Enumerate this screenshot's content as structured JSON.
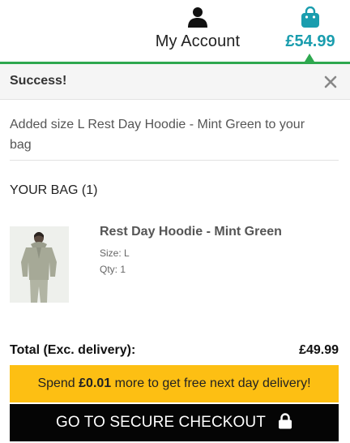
{
  "header": {
    "account_label": "My Account",
    "account_icon": "user-icon",
    "bag_total": "£54.99",
    "bag_icon": "shopping-bag-icon",
    "accent_color": "#1a9dae",
    "underline_color": "#2ea84f"
  },
  "notification": {
    "title": "Success!",
    "close_icon": "close-icon",
    "message": "Added size L Rest Day Hoodie - Mint Green to your bag"
  },
  "bag": {
    "heading": "YOUR BAG (1)",
    "items": [
      {
        "name": "Rest Day Hoodie - Mint Green",
        "size": "Size: L",
        "qty": "Qty: 1",
        "image": "hoodie-product-image"
      }
    ]
  },
  "totals": {
    "label": "Total (Exc. delivery):",
    "value": "£49.99"
  },
  "promo": {
    "prefix": "Spend ",
    "amount": "£0.01",
    "suffix": " more to get free next day delivery!",
    "color": "#fdbf13"
  },
  "checkout": {
    "label": "GO TO SECURE CHECKOUT",
    "icon": "lock-icon"
  }
}
